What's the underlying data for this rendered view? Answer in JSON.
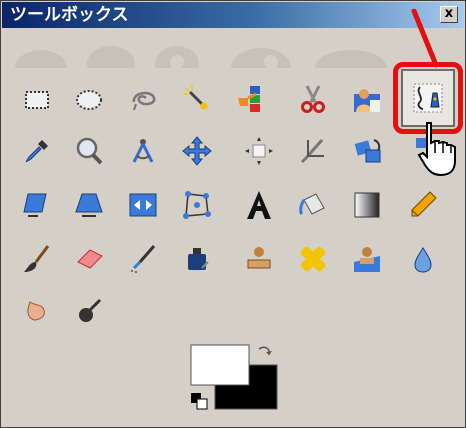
{
  "window": {
    "title": "ツールボックス",
    "close_label": "x"
  },
  "tools": [
    {
      "name": "rect-select-tool-icon"
    },
    {
      "name": "ellipse-select-tool-icon"
    },
    {
      "name": "free-select-tool-icon"
    },
    {
      "name": "fuzzy-select-tool-icon"
    },
    {
      "name": "select-by-color-tool-icon"
    },
    {
      "name": "scissors-select-tool-icon"
    },
    {
      "name": "foreground-select-tool-icon"
    },
    {
      "name": "paths-tool-icon"
    },
    {
      "name": "color-picker-tool-icon"
    },
    {
      "name": "zoom-tool-icon"
    },
    {
      "name": "measure-tool-icon"
    },
    {
      "name": "move-tool-icon"
    },
    {
      "name": "align-tool-icon"
    },
    {
      "name": "crop-tool-icon"
    },
    {
      "name": "rotate-tool-icon"
    },
    {
      "name": "scale-tool-icon"
    },
    {
      "name": "shear-tool-icon"
    },
    {
      "name": "perspective-tool-icon"
    },
    {
      "name": "flip-tool-icon"
    },
    {
      "name": "cage-transform-tool-icon"
    },
    {
      "name": "text-tool-icon"
    },
    {
      "name": "bucket-fill-tool-icon"
    },
    {
      "name": "blend-tool-icon"
    },
    {
      "name": "pencil-tool-icon"
    },
    {
      "name": "paintbrush-tool-icon"
    },
    {
      "name": "eraser-tool-icon"
    },
    {
      "name": "airbrush-tool-icon"
    },
    {
      "name": "ink-tool-icon"
    },
    {
      "name": "clone-tool-icon"
    },
    {
      "name": "heal-tool-icon"
    },
    {
      "name": "perspective-clone-tool-icon"
    },
    {
      "name": "blur-sharpen-tool-icon"
    },
    {
      "name": "smudge-tool-icon"
    },
    {
      "name": "dodge-burn-tool-icon"
    }
  ],
  "colors": {
    "foreground": "#ffffff",
    "background": "#000000",
    "highlight": "#e21010"
  }
}
